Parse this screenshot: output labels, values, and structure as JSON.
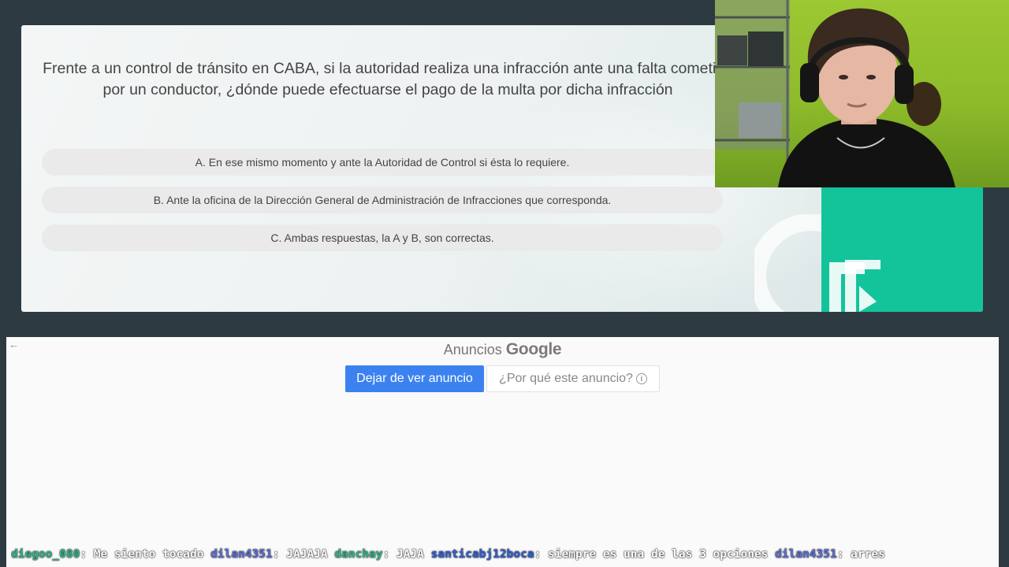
{
  "quiz": {
    "question": "Frente a un control de tránsito en CABA, si la autoridad realiza una infracción ante una falta cometida por un conductor, ¿dónde puede efectuarse el pago de la multa por dicha infracción",
    "answers": [
      "A. En ese mismo momento y ante la Autoridad de Control si ésta lo requiere.",
      "B. Ante la oficina de la Dirección General de Administración de Infracciones que corresponda.",
      "C. Ambas respuestas, la A y B, son correctas."
    ],
    "brand_color": "#13c49b"
  },
  "ad": {
    "back_arrow": "←",
    "title_prefix": "Anuncios",
    "title_brand": "Google",
    "stop_label": "Dejar de ver anuncio",
    "why_label": "¿Por qué este anuncio?",
    "info_glyph": "i",
    "stop_color": "#3b82f0"
  },
  "chat": {
    "messages": [
      {
        "user": "diegoo_080",
        "user_color": "#2fb58a",
        "text": "Me siento tocado"
      },
      {
        "user": "dilan4351",
        "user_color": "#5a6fd8",
        "text": "JAJAJA"
      },
      {
        "user": "danchay",
        "user_color": "#2fb58a",
        "text": "JAJA"
      },
      {
        "user": "santicabj12boca",
        "user_color": "#2f5fd8",
        "text": "siempre es una de las 3 opciones"
      },
      {
        "user": "dilan4351",
        "user_color": "#5a6fd8",
        "text": "arres"
      }
    ]
  }
}
